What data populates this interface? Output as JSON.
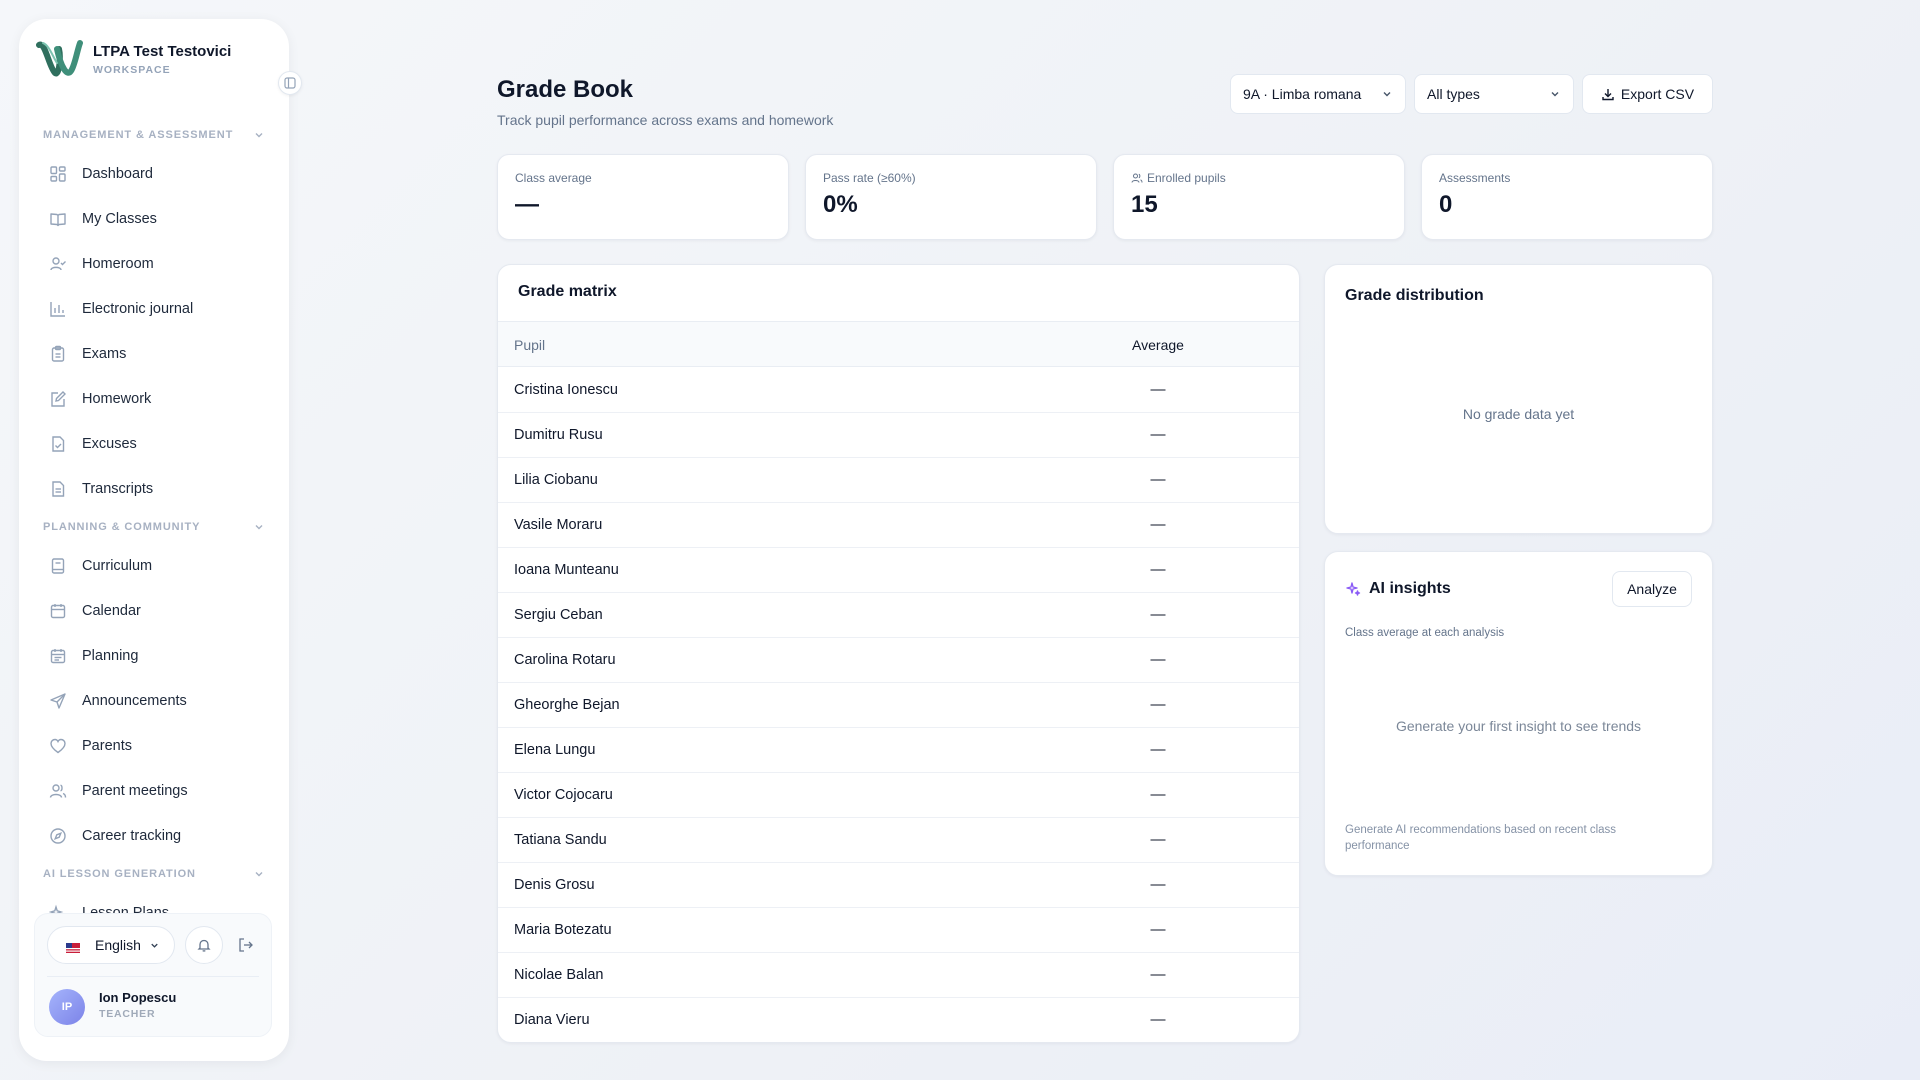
{
  "sidebar": {
    "brand_name": "LTPA Test Testovici",
    "brand_sub": "WORKSPACE",
    "sections": [
      {
        "title": "MANAGEMENT & ASSESSMENT",
        "items": [
          {
            "label": "Dashboard",
            "icon": "dashboard-icon"
          },
          {
            "label": "My Classes",
            "icon": "book-open-icon"
          },
          {
            "label": "Homeroom",
            "icon": "user-check-icon"
          },
          {
            "label": "Electronic journal",
            "icon": "bar-chart-icon"
          },
          {
            "label": "Exams",
            "icon": "clipboard-icon"
          },
          {
            "label": "Homework",
            "icon": "edit-icon"
          },
          {
            "label": "Excuses",
            "icon": "file-check-icon"
          },
          {
            "label": "Transcripts",
            "icon": "file-text-icon"
          }
        ]
      },
      {
        "title": "PLANNING & COMMUNITY",
        "items": [
          {
            "label": "Curriculum",
            "icon": "notebook-icon"
          },
          {
            "label": "Calendar",
            "icon": "calendar-icon"
          },
          {
            "label": "Planning",
            "icon": "calendar-range-icon"
          },
          {
            "label": "Announcements",
            "icon": "send-icon"
          },
          {
            "label": "Parents",
            "icon": "heart-icon"
          },
          {
            "label": "Parent meetings",
            "icon": "users-icon"
          },
          {
            "label": "Career tracking",
            "icon": "compass-icon"
          }
        ]
      },
      {
        "title": "AI LESSON GENERATION",
        "items": [
          {
            "label": "Lesson Plans",
            "icon": "sparkles-icon"
          }
        ]
      }
    ],
    "language": "English",
    "user": {
      "initials": "IP",
      "name": "Ion Popescu",
      "role": "TEACHER"
    }
  },
  "header": {
    "title": "Grade Book",
    "subtitle": "Track pupil performance across exams and homework",
    "class_select": "9A · Limba romana",
    "type_select": "All types",
    "export_label": "Export CSV"
  },
  "stats": [
    {
      "label": "Class average",
      "value": "—"
    },
    {
      "label": "Pass rate (≥60%)",
      "value": "0%"
    },
    {
      "label": "Enrolled pupils",
      "value": "15"
    },
    {
      "label": "Assessments",
      "value": "0"
    }
  ],
  "matrix": {
    "title": "Grade matrix",
    "col_pupil": "Pupil",
    "col_average": "Average",
    "rows": [
      {
        "name": "Cristina Ionescu",
        "avg": "—"
      },
      {
        "name": "Dumitru Rusu",
        "avg": "—"
      },
      {
        "name": "Lilia Ciobanu",
        "avg": "—"
      },
      {
        "name": "Vasile Moraru",
        "avg": "—"
      },
      {
        "name": "Ioana Munteanu",
        "avg": "—"
      },
      {
        "name": "Sergiu Ceban",
        "avg": "—"
      },
      {
        "name": "Carolina Rotaru",
        "avg": "—"
      },
      {
        "name": "Gheorghe Bejan",
        "avg": "—"
      },
      {
        "name": "Elena Lungu",
        "avg": "—"
      },
      {
        "name": "Victor Cojocaru",
        "avg": "—"
      },
      {
        "name": "Tatiana Sandu",
        "avg": "—"
      },
      {
        "name": "Denis Grosu",
        "avg": "—"
      },
      {
        "name": "Maria Botezatu",
        "avg": "—"
      },
      {
        "name": "Nicolae Balan",
        "avg": "—"
      },
      {
        "name": "Diana Vieru",
        "avg": "—"
      }
    ]
  },
  "distribution": {
    "title": "Grade distribution",
    "empty": "No grade data yet"
  },
  "ai": {
    "title": "AI insights",
    "analyze_label": "Analyze",
    "caption": "Class average at each analysis",
    "empty": "Generate your first insight to see trends",
    "footer": "Generate AI recommendations based on recent class performance"
  },
  "colors": {
    "accent_purple": "#8b5cf6",
    "logo_green": "#2f6f5e",
    "text_primary": "#0f172a",
    "text_muted": "#64748b"
  }
}
